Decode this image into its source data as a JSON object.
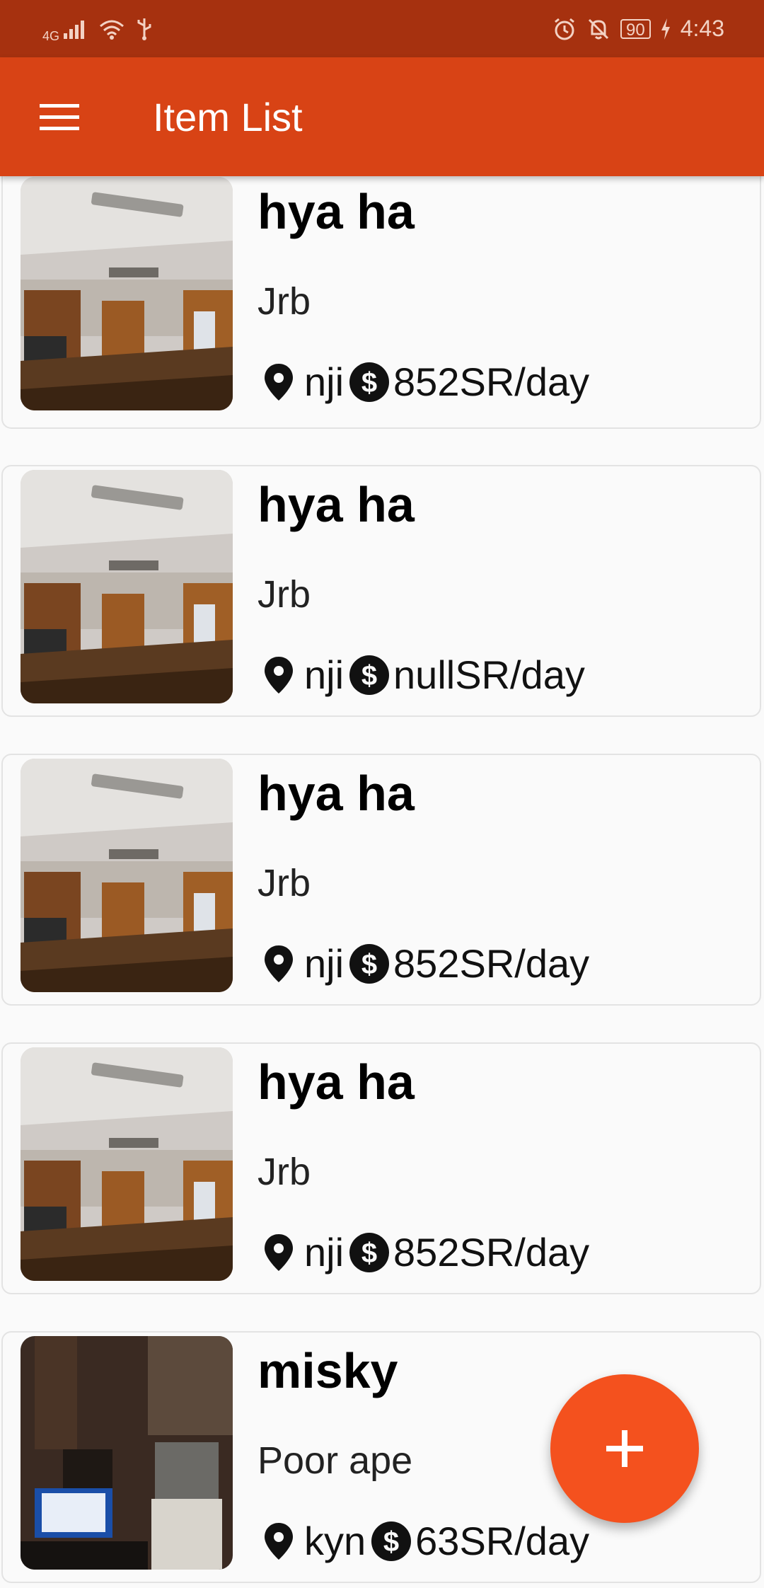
{
  "status_bar": {
    "network": "4G",
    "battery": "90",
    "time": "4:43",
    "icons": [
      "signal-icon",
      "wifi-icon",
      "usb-icon",
      "alarm-icon",
      "mute-icon",
      "battery-icon",
      "charging-icon"
    ]
  },
  "app_bar": {
    "title": "Item List",
    "menu_icon": "menu-icon"
  },
  "items": [
    {
      "title": "hya ha",
      "subtitle": "Jrb",
      "location": "nji",
      "price": "852SR/day",
      "image": "ceiling-room-photo"
    },
    {
      "title": "hya ha",
      "subtitle": "Jrb",
      "location": "nji",
      "price": "nullSR/day",
      "image": "ceiling-room-photo"
    },
    {
      "title": "hya ha",
      "subtitle": "Jrb",
      "location": "nji",
      "price": "852SR/day",
      "image": "ceiling-room-photo"
    },
    {
      "title": "hya ha",
      "subtitle": "Jrb",
      "location": "nji",
      "price": "852SR/day",
      "image": "ceiling-room-photo"
    },
    {
      "title": "misky",
      "subtitle": "Poor ape",
      "location": "kyn",
      "price": "63SR/day",
      "image": "dark-room-photo"
    }
  ],
  "fab": {
    "icon": "add-icon"
  },
  "colors": {
    "status_bar": "#a6310f",
    "app_bar": "#d84315",
    "fab": "#f4511e",
    "background": "#fafafa"
  }
}
